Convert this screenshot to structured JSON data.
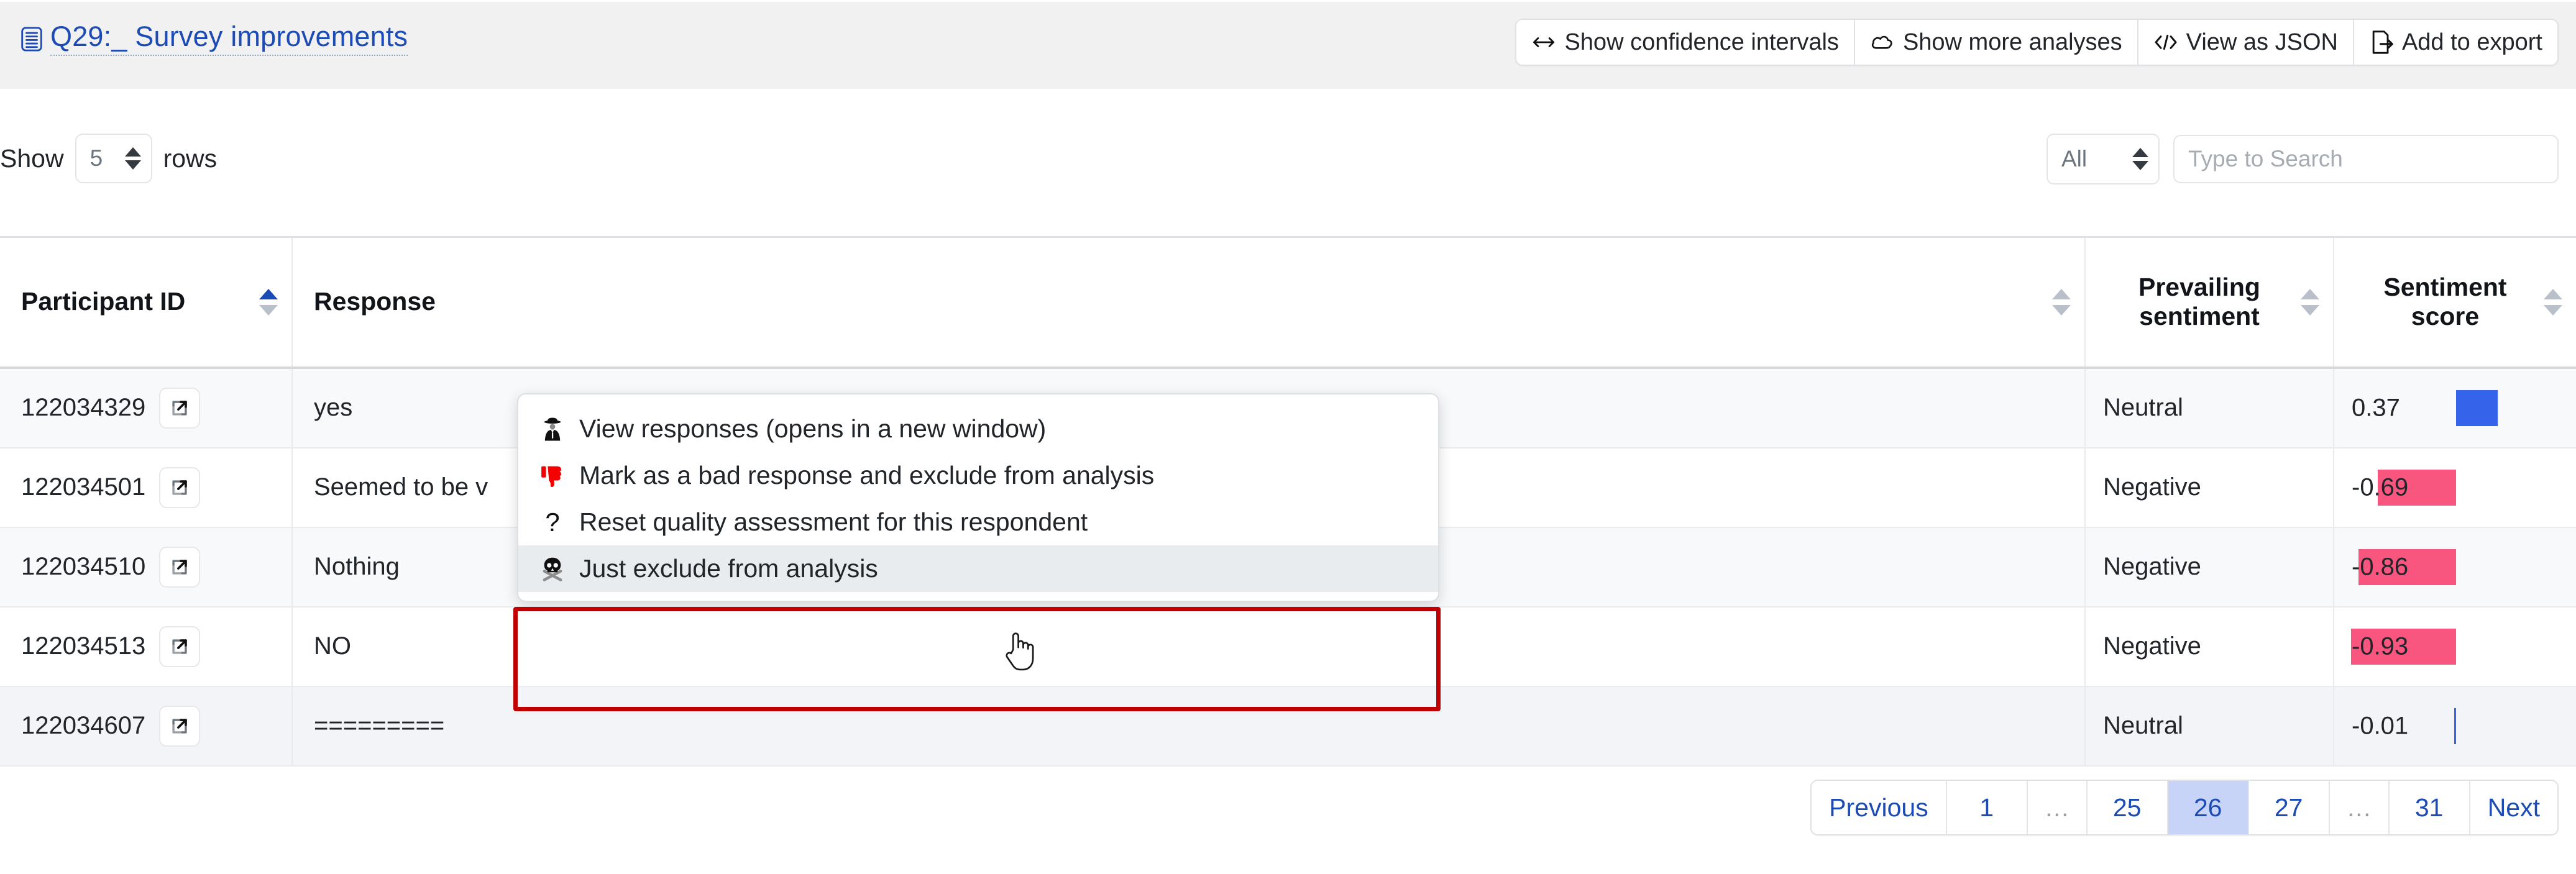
{
  "header": {
    "icon": "document-lines-icon",
    "title_prefix": "Q29:",
    "title_underscore": "_",
    "title_rest": "Survey improvements",
    "title_full": "Q29:_ Survey improvements",
    "accent_color": "#1c4bb5",
    "band_color": "#f1f1f2"
  },
  "toolbar": {
    "buttons": [
      {
        "icon": "left-right-arrow-icon",
        "label": "Show confidence intervals"
      },
      {
        "icon": "cloud-icon",
        "label": "Show more analyses"
      },
      {
        "icon": "code-brackets-icon",
        "label": "View as JSON"
      },
      {
        "icon": "export-arrow-icon",
        "label": "Add to export"
      }
    ]
  },
  "controls": {
    "show_label": "Show",
    "rows_value": "5",
    "rows_label": "rows",
    "filter_value": "All",
    "search_placeholder": "Type to Search",
    "search_value": ""
  },
  "table": {
    "columns": [
      {
        "key": "participant_id",
        "label": "Participant ID",
        "sort": "asc"
      },
      {
        "key": "response",
        "label": "Response",
        "sort": "none"
      },
      {
        "key": "prevailing_sentiment",
        "label": "Prevailing sentiment",
        "sort": "none"
      },
      {
        "key": "sentiment_score",
        "label": "Sentiment score",
        "sort": "none"
      }
    ],
    "rows": [
      {
        "participant_id": "122034329",
        "response": "yes",
        "prevailing_sentiment": "Neutral",
        "sentiment_score": "0.37"
      },
      {
        "participant_id": "122034501",
        "response": "Seemed to be v",
        "prevailing_sentiment": "Negative",
        "sentiment_score": "-0.69"
      },
      {
        "participant_id": "122034510",
        "response": "Nothing",
        "prevailing_sentiment": "Negative",
        "sentiment_score": "-0.86"
      },
      {
        "participant_id": "122034513",
        "response": "NO",
        "prevailing_sentiment": "Negative",
        "sentiment_score": "-0.93"
      },
      {
        "participant_id": "122034607",
        "response": "=========",
        "prevailing_sentiment": "Neutral",
        "sentiment_score": "-0.01"
      }
    ],
    "row_action_icon": "external-link-icon",
    "colors": {
      "positive_bar": "#3563e9",
      "negative_bar": "#f8557f"
    }
  },
  "context_menu": {
    "items": [
      {
        "icon": "detective-icon",
        "label": "View responses (opens in a new window)",
        "active": false
      },
      {
        "icon": "thumbs-down-icon",
        "label": "Mark as a bad response and exclude from analysis",
        "active": false
      },
      {
        "icon": "question-mark-icon",
        "label": "Reset quality assessment for this respondent",
        "active": false
      },
      {
        "icon": "skull-crossbones-icon",
        "label": "Just exclude from analysis",
        "active": true
      }
    ],
    "highlight_color": "#c00000"
  },
  "pagination": {
    "items": [
      {
        "label": "Previous",
        "type": "nav",
        "active": false
      },
      {
        "label": "1",
        "type": "page",
        "active": false
      },
      {
        "label": "…",
        "type": "ellipsis",
        "active": false
      },
      {
        "label": "25",
        "type": "page",
        "active": false
      },
      {
        "label": "26",
        "type": "page",
        "active": true
      },
      {
        "label": "27",
        "type": "page",
        "active": false
      },
      {
        "label": "…",
        "type": "ellipsis",
        "active": false
      },
      {
        "label": "31",
        "type": "page",
        "active": false
      },
      {
        "label": "Next",
        "type": "nav",
        "active": false
      }
    ],
    "active_bg": "#c8d4f7"
  }
}
